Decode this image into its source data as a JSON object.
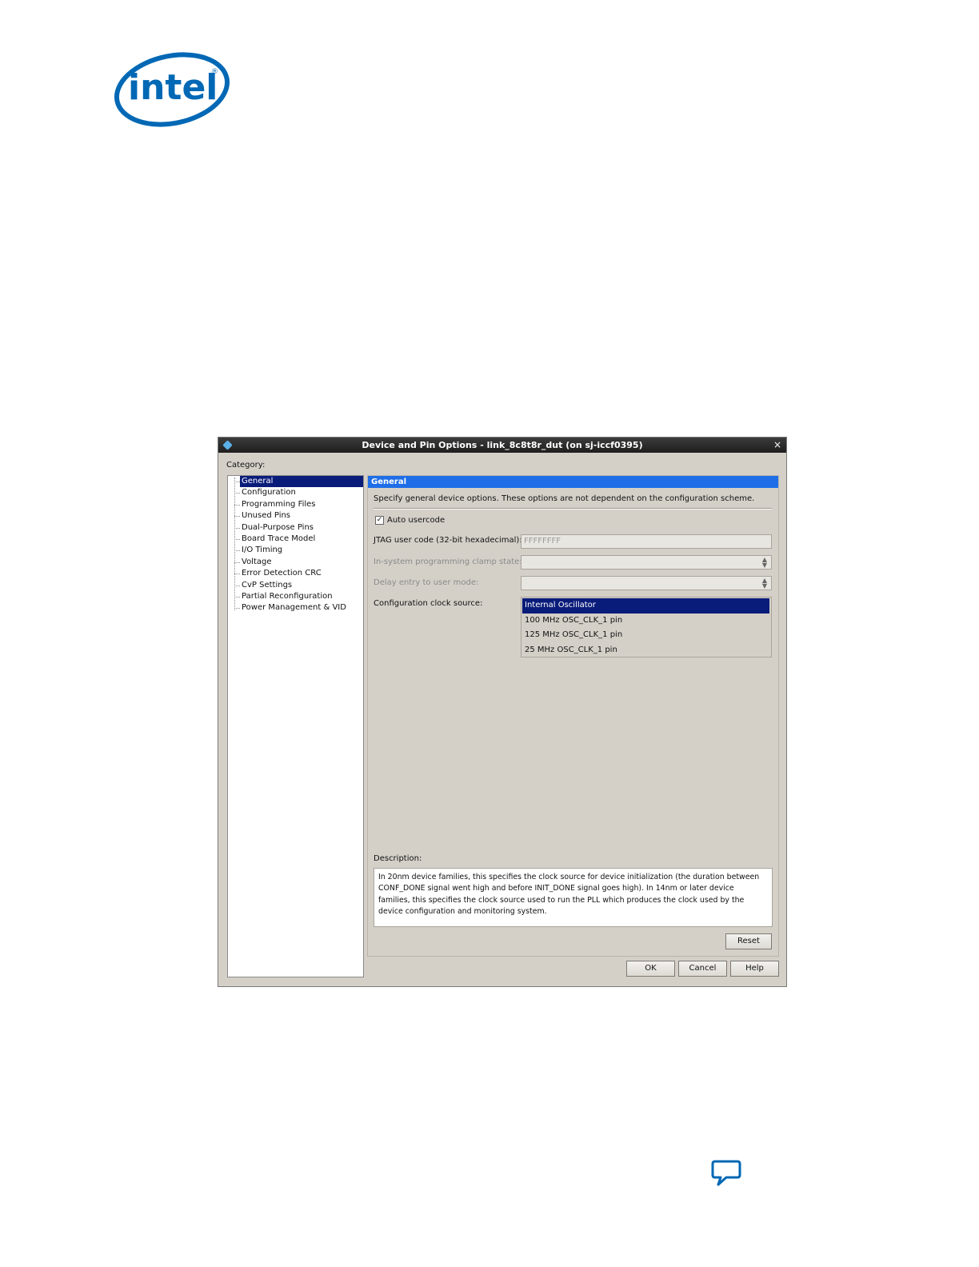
{
  "logo": {
    "text": "intel",
    "mark": "®"
  },
  "dialog": {
    "title": "Device and Pin Options - link_8c8t8r_dut (on sj-iccf0395)",
    "close_label": "×",
    "category_label": "Category:",
    "tree_items": [
      "General",
      "Configuration",
      "Programming Files",
      "Unused Pins",
      "Dual-Purpose Pins",
      "Board Trace Model",
      "I/O Timing",
      "Voltage",
      "Error Detection CRC",
      "CvP Settings",
      "Partial Reconfiguration",
      "Power Management & VID"
    ],
    "selected_item": "General",
    "panel": {
      "header": "General",
      "description": "Specify general device options. These options are not dependent on the configuration scheme.",
      "auto_usercode": {
        "label": "Auto usercode",
        "checked": true
      },
      "jtag_label": "JTAG user code (32-bit hexadecimal):",
      "jtag_value": "FFFFFFFF",
      "isp_clamp_label": "In-system programming clamp state:",
      "isp_clamp_value": "",
      "delay_entry_label": "Delay entry to user mode:",
      "delay_entry_value": "",
      "clock_source_label": "Configuration clock source:",
      "clock_source_options": [
        "Internal Oscillator",
        "100 MHz OSC_CLK_1 pin",
        "125 MHz OSC_CLK_1 pin",
        "25 MHz OSC_CLK_1 pin"
      ],
      "clock_source_selected": "Internal Oscillator",
      "description_label": "Description:",
      "description_text": "In 20nm device families, this specifies the clock source for device initialization (the duration between CONF_DONE signal went high and before INIT_DONE signal goes high). In 14nm or later device families, this specifies the clock source used to run the PLL which produces the clock used by the device configuration and monitoring system.",
      "reset_label": "Reset"
    },
    "buttons": {
      "ok": "OK",
      "cancel": "Cancel",
      "help": "Help"
    }
  },
  "colors": {
    "intel_blue": "#0068b5",
    "selection": "#0a1c7a",
    "panel_header": "#1f6ee8"
  },
  "icons": {
    "feedback": "speech-bubble-icon"
  }
}
